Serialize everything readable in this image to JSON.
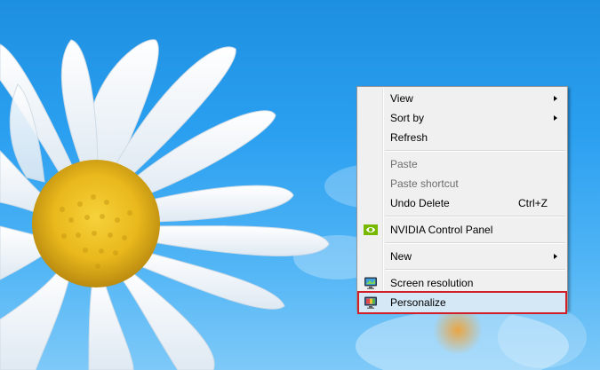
{
  "context_menu": {
    "items": {
      "view": {
        "label": "View"
      },
      "sort_by": {
        "label": "Sort by"
      },
      "refresh": {
        "label": "Refresh"
      },
      "paste": {
        "label": "Paste"
      },
      "paste_shortcut": {
        "label": "Paste shortcut"
      },
      "undo_delete": {
        "label": "Undo Delete",
        "shortcut": "Ctrl+Z"
      },
      "nvidia": {
        "label": "NVIDIA Control Panel",
        "icon": "nvidia-icon"
      },
      "new": {
        "label": "New"
      },
      "screen_resolution": {
        "label": "Screen resolution",
        "icon": "monitor-icon"
      },
      "personalize": {
        "label": "Personalize",
        "icon": "personalize-icon"
      }
    },
    "highlight_color": "#d11f2a"
  }
}
